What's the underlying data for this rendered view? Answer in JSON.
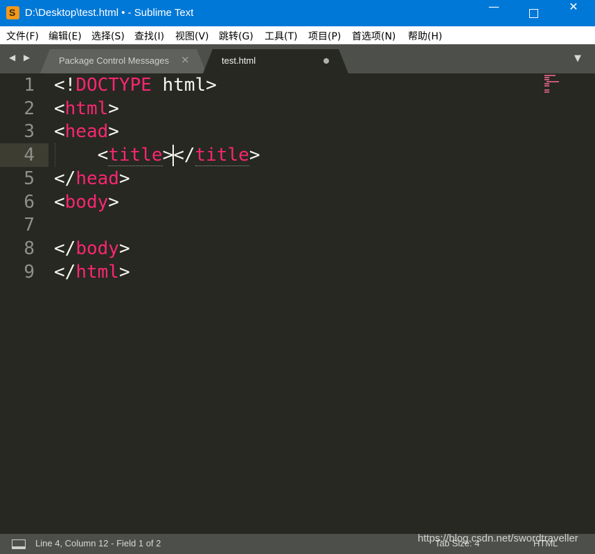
{
  "window": {
    "title": "D:\\Desktop\\test.html • - Sublime Text",
    "app_icon_glyph": "S",
    "minimize_glyph": "—",
    "close_glyph": "✕"
  },
  "menu": [
    "文件(F)",
    "编辑(E)",
    "选择(S)",
    "查找(I)",
    "视图(V)",
    "跳转(G)",
    "工具(T)",
    "项目(P)",
    "首选项(N)",
    "帮助(H)"
  ],
  "tabs": {
    "nav_arrows": "◀ ▶",
    "inactive": {
      "label": "Package Control Messages",
      "close_glyph": "×"
    },
    "active": {
      "label": "test.html"
    },
    "dropdown_glyph": "▼"
  },
  "editor": {
    "line_numbers": [
      "1",
      "2",
      "3",
      "4",
      "5",
      "6",
      "7",
      "8",
      "9"
    ],
    "current_line": 4,
    "code": {
      "l1_open": "<!",
      "l1_tag": "DOCTYPE",
      "l1_rest": " html>",
      "l2_open": "<",
      "l2_tag": "html",
      "l2_close": ">",
      "l3_open": "<",
      "l3_tag": "head",
      "l3_close": ">",
      "l4_indent": "    ",
      "l4_open": "<",
      "l4_tag": "title",
      "l4_close": ">",
      "l4_open2": "</",
      "l4_tag2": "title",
      "l4_close2": ">",
      "l5_open": "</",
      "l5_tag": "head",
      "l5_close": ">",
      "l6_open": "<",
      "l6_tag": "body",
      "l6_close": ">",
      "l8_open": "</",
      "l8_tag": "body",
      "l8_close": ">",
      "l9_open": "</",
      "l9_tag": "html",
      "l9_close": ">"
    }
  },
  "status": {
    "position": "Line 4, Column 12 - Field 1 of 2",
    "tab_size": "Tab Size: 4",
    "syntax": "HTML"
  },
  "watermark": "https://blog.csdn.net/swordtraveller",
  "colors": {
    "titlebar": "#0078d7",
    "editor_bg": "#272822",
    "tag": "#f92672",
    "text": "#f8f8f2",
    "line_number": "#8f908a",
    "chrome": "#4d4f4b"
  }
}
